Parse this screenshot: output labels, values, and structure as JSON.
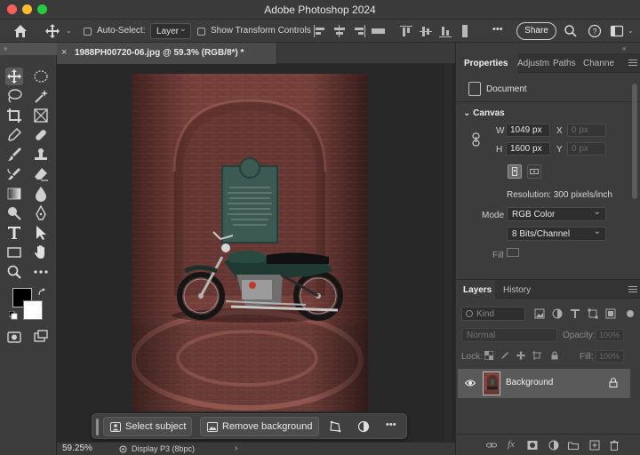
{
  "window": {
    "title": "Adobe Photoshop 2024"
  },
  "options_bar": {
    "auto_select_label": "Auto-Select:",
    "auto_select_target": "Layer",
    "transform_controls_label": "Show Transform Controls",
    "more_label": "•••",
    "share_label": "Share"
  },
  "document": {
    "tab_close": "×",
    "tab_title": "1988PH00720-06.jpg @ 59.3% (RGB/8*) *"
  },
  "context_bar": {
    "select_subject": "Select subject",
    "remove_background": "Remove background",
    "more_label": "•••"
  },
  "status_bar": {
    "zoom": "59.25%",
    "profile": "Display P3 (8bpc)",
    "arrow": "›"
  },
  "properties": {
    "tabs": [
      "Properties",
      "Adjustm",
      "Paths",
      "Channe"
    ],
    "document_label": "Document",
    "canvas_label": "Canvas",
    "width_label": "W",
    "width_value": "1049 px",
    "height_label": "H",
    "height_value": "1600 px",
    "x_label": "X",
    "x_value": "0 px",
    "y_label": "Y",
    "y_value": "0 px",
    "resolution": "Resolution: 300 pixels/inch",
    "mode_label": "Mode",
    "mode_value": "RGB Color",
    "depth_value": "8 Bits/Channel",
    "fill_label": "Fill"
  },
  "layers": {
    "tabs": [
      "Layers",
      "History"
    ],
    "kind_placeholder": "Kind",
    "blend_mode": "Normal",
    "opacity_label": "Opacity:",
    "opacity_value": "100%",
    "lock_label": "Lock:",
    "fill_label": "Fill:",
    "fill_value": "100%",
    "items": [
      {
        "name": "Background",
        "visible": true,
        "locked": true
      }
    ]
  },
  "colors": {
    "foreground": "#000000",
    "background": "#ffffff",
    "accent": "#fe5f57"
  }
}
